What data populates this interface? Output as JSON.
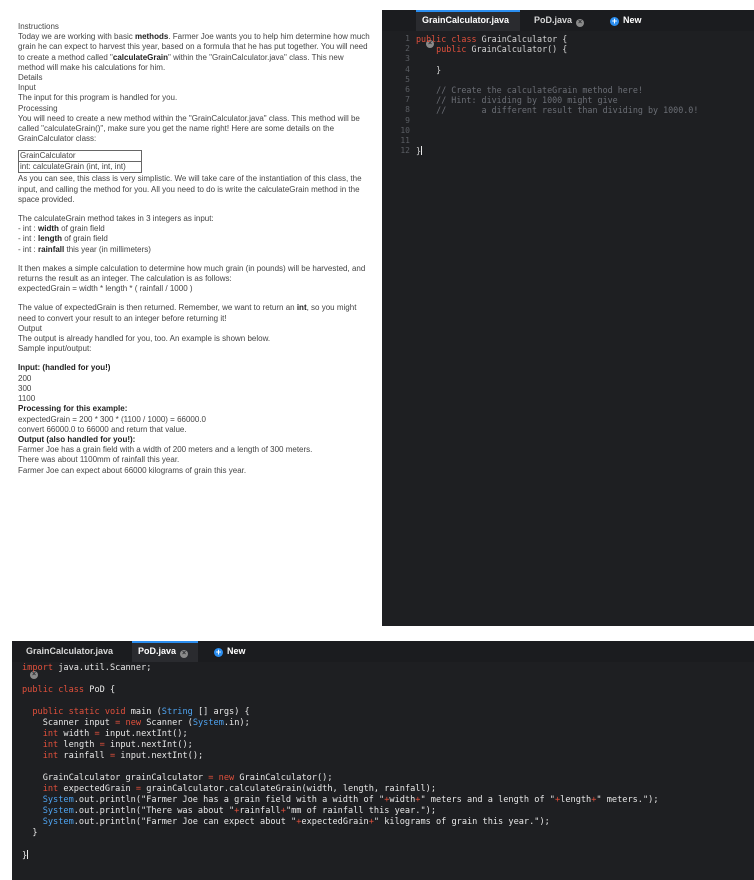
{
  "instructions": {
    "heading": "Instructions",
    "intro_pre": "Today we are working with basic ",
    "intro_bold": "methods",
    "intro_mid": ". Farmer Joe wants you to help him determine how much grain he can expect to harvest this year, based on a formula that he has put together. You will need to create a method called \"",
    "intro_method": "calculateGrain",
    "intro_post": "\" within the \"GrainCalculator.java\" class. This new method will make his calculations for him.",
    "details": "Details",
    "input_heading": "Input",
    "input_text": "The input for this program is handled for you.",
    "processing_heading": "Processing",
    "processing_text": "You will need to create a new method within the \"GrainCalculator.java\" class. This method will be called \"calculateGrain()\", make sure you get the name right! Here are some details on the GrainCalculator class:",
    "class_table": {
      "name": "GrainCalculator",
      "method": "int: calculateGrain (int, int, int)"
    },
    "simplistic_text": "As you can see, this class is very simplistic. We will take care of the instantiation of this class, the input, and calling the method for you. All you need to do is write the calculateGrain method in the space provided.",
    "takes_text": "The calculateGrain method takes in 3 integers as input:",
    "params": [
      {
        "prefix": "- int : ",
        "name": "width",
        "suffix": " of grain field"
      },
      {
        "prefix": "- int : ",
        "name": "length",
        "suffix": " of grain field"
      },
      {
        "prefix": "- int : ",
        "name": "rainfall",
        "suffix": " this year (in millimeters)"
      }
    ],
    "calc_text": "It then makes a simple calculation to determine how much grain (in pounds) will be harvested, and returns the result as an integer. The calculation is as follows:",
    "formula": "expectedGrain = width * length * ( rainfall / 1000 )",
    "return_pre": "The value of expectedGrain is then returned. Remember, we want to return an ",
    "return_bold": "int",
    "return_post": ", so you might need to convert your result to an integer before returning it!",
    "output_heading": "Output",
    "output_text": "The output is already handled for you, too. An example is shown below.",
    "sample_label": "Sample input/output:",
    "input_label": "Input: (handled for you!)",
    "input_values": [
      "200",
      "300",
      "1100"
    ],
    "processing_label": "Processing for this example:",
    "processing_line1": "expectedGrain = 200 * 300 * (1100 / 1000) = 66000.0",
    "processing_line2": "convert 66000.0 to 66000 and return that value.",
    "output_label": "Output (also handled for you!):",
    "output_lines": [
      "Farmer Joe has a grain field with a width of 200 meters and a length of 300 meters.",
      "There was about 1100mm of rainfall this year.",
      "Farmer Joe can expect about 66000 kilograms of grain this year."
    ]
  },
  "editor1": {
    "tabs": [
      "GrainCalculator.java",
      "PoD.java"
    ],
    "new_tab": "New",
    "close_glyph": "×",
    "plus_glyph": "+",
    "line_numbers": [
      "1",
      "2",
      "3",
      "4",
      "5",
      "6",
      "7",
      "8",
      "9",
      "10",
      "11",
      "12"
    ],
    "fold_markers": [
      "1",
      "2"
    ],
    "code": {
      "l1_kw1": "public",
      "l1_kw2": "class",
      "l1_name": "GrainCalculator",
      "l1_brace": "{",
      "l2_kw": "public",
      "l2_name": "GrainCalculator()",
      "l2_brace": "{",
      "l4": "}",
      "l6": "// Create the calculateGrain method here!",
      "l7": "// Hint: dividing by 1000 might give",
      "l8": "//       a different result than dividing by 1000.0!",
      "l12": "}"
    }
  },
  "editor2": {
    "tabs": [
      "GrainCalculator.java",
      "PoD.java"
    ],
    "new_tab": "New",
    "close_glyph": "×",
    "plus_glyph": "+",
    "code": {
      "l1_kw": "import",
      "l1_rest": "java.util.Scanner;",
      "l3_kw1": "public",
      "l3_kw2": "class",
      "l3_rest": "PoD {",
      "l5_kw1": "public",
      "l5_kw2": "static",
      "l5_kw3": "void",
      "l5_mid": "main (",
      "l5_type": "String",
      "l5_end": " [] args) {",
      "l6_a": "Scanner input",
      "l6_eq": "=",
      "l6_new": "new",
      "l6_b": "Scanner (",
      "l6_sys": "System",
      "l6_c": ".in);",
      "l7_int": "int",
      "l7_rest": "width",
      "l7_eq": "=",
      "l7_val": "input.nextInt();",
      "l8_int": "int",
      "l8_rest": "length",
      "l8_eq": "=",
      "l8_val": "input.nextInt();",
      "l9_int": "int",
      "l9_rest": "rainfall",
      "l9_eq": "=",
      "l9_val": "input.nextInt();",
      "l11_a": "GrainCalculator grainCalculator",
      "l11_eq": "=",
      "l11_new": "new",
      "l11_b": "GrainCalculator();",
      "l12_int": "int",
      "l12_a": "expectedGrain",
      "l12_eq": "=",
      "l12_b": "grainCalculator.calculateGrain(width, length, rainfall);",
      "l13_sys": "System",
      "l13_a": ".out.println(",
      "l13_s1": "\"Farmer Joe has a grain field with a width of \"",
      "l13_p1": "+",
      "l13_v1": "width",
      "l13_p2": "+",
      "l13_s2": "\" meters and a length of \"",
      "l13_p3": "+",
      "l13_v2": "length",
      "l13_p4": "+",
      "l13_s3": "\" meters.\"",
      "l13_end": ");",
      "l14_sys": "System",
      "l14_a": ".out.println(",
      "l14_s1": "\"There was about \"",
      "l14_p1": "+",
      "l14_v1": "rainfall",
      "l14_p2": "+",
      "l14_s2": "\"mm of rainfall this year.\"",
      "l14_end": ");",
      "l15_sys": "System",
      "l15_a": ".out.println(",
      "l15_s1": "\"Farmer Joe can expect about \"",
      "l15_p1": "+",
      "l15_v1": "expectedGrain",
      "l15_p2": "+",
      "l15_s2": "\" kilograms of grain this year.\"",
      "l15_end": ");",
      "l16": "}",
      "l18": "}"
    }
  },
  "colors": {
    "editor_bg": "#1e1f22",
    "keyword": "#e0503c",
    "type": "#4ea3f0",
    "comment": "#6b6e75",
    "accent": "#2b8ef0"
  }
}
